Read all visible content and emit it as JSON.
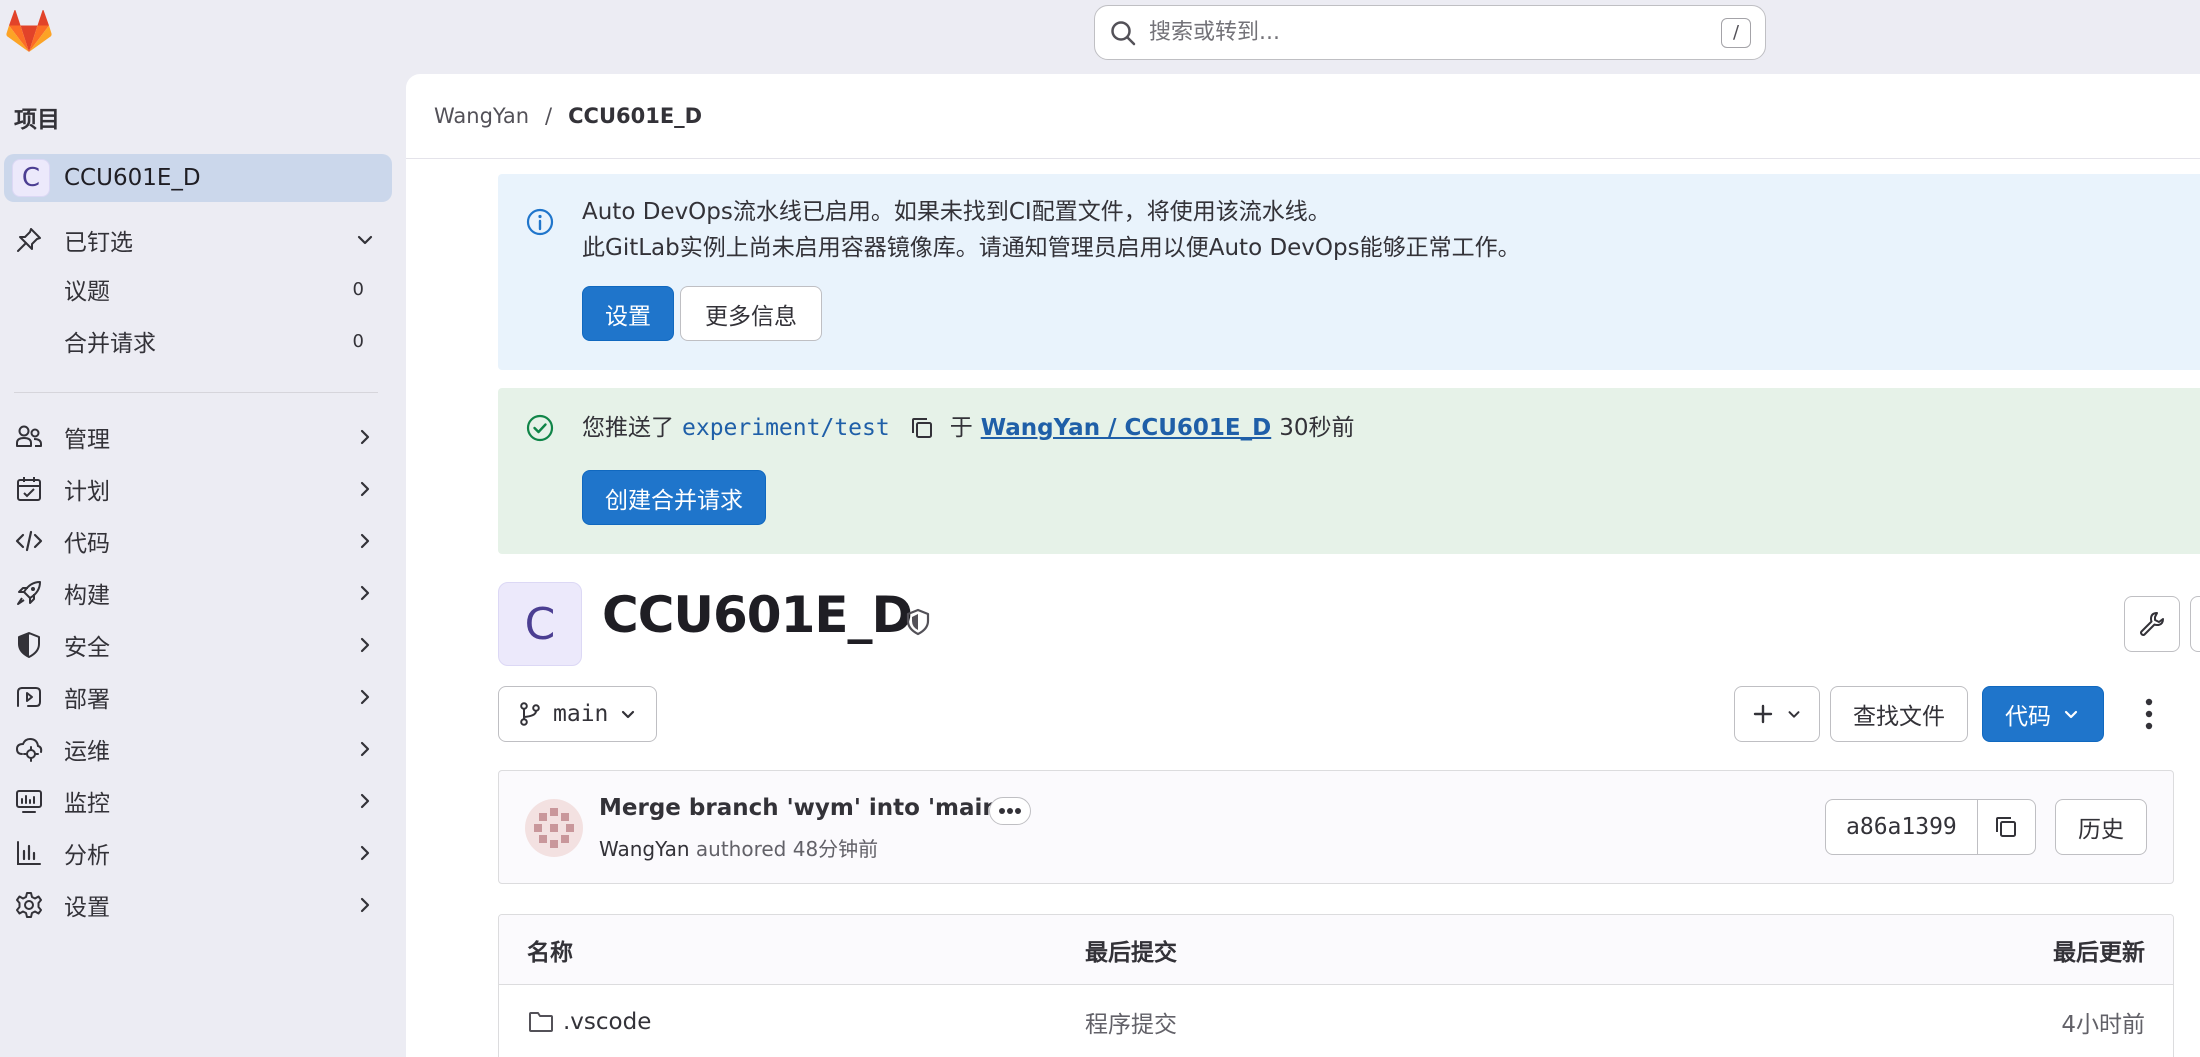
{
  "search": {
    "placeholder": "搜索或转到...",
    "shortcut": "/"
  },
  "sidebar": {
    "heading": "项目",
    "project": {
      "avatar_letter": "C",
      "name": "CCU601E_D"
    },
    "pinned": {
      "label": "已钉选",
      "items": [
        {
          "label": "议题",
          "count": "0"
        },
        {
          "label": "合并请求",
          "count": "0"
        }
      ]
    },
    "items": [
      {
        "label": "管理",
        "icon": "users-icon"
      },
      {
        "label": "计划",
        "icon": "calendar-icon"
      },
      {
        "label": "代码",
        "icon": "code-icon"
      },
      {
        "label": "构建",
        "icon": "rocket-icon"
      },
      {
        "label": "安全",
        "icon": "shield-icon"
      },
      {
        "label": "部署",
        "icon": "deployments-icon"
      },
      {
        "label": "运维",
        "icon": "cloud-gear-icon"
      },
      {
        "label": "监控",
        "icon": "monitor-icon"
      },
      {
        "label": "分析",
        "icon": "chart-icon"
      },
      {
        "label": "设置",
        "icon": "gear-icon"
      }
    ]
  },
  "breadcrumb": {
    "owner": "WangYan",
    "separator": "/",
    "project": "CCU601E_D"
  },
  "alert_info": {
    "line1": "Auto DevOps流水线已启用。如果未找到CI配置文件，将使用该流水线。",
    "line2": "此GitLab实例上尚未启用容器镜像库。请通知管理员启用以便Auto DevOps能够正常工作。",
    "primary_btn": "设置",
    "secondary_btn": "更多信息"
  },
  "alert_success": {
    "prefix": "您推送了",
    "branch": "experiment/test",
    "mid": "于",
    "link": "WangYan / CCU601E_D",
    "time": "30秒前",
    "button": "创建合并请求"
  },
  "project": {
    "avatar_letter": "C",
    "title": "CCU601E_D"
  },
  "toolbar": {
    "branch": "main",
    "find_file": "查找文件",
    "code": "代码"
  },
  "commit": {
    "message": "Merge branch 'wym' into 'main'",
    "author": "WangYan",
    "authored": "authored",
    "time": "48分钟前",
    "sha": "a86a1399",
    "history": "历史"
  },
  "files": {
    "headers": {
      "name": "名称",
      "last_commit": "最后提交",
      "last_update": "最后更新"
    },
    "rows": [
      {
        "name": ".vscode",
        "last_commit": "程序提交",
        "last_update": "4小时前"
      }
    ]
  },
  "colors": {
    "brand": "#fc6d26",
    "primary": "#1f75cb",
    "info_bg": "#e9f3fc",
    "success_bg": "#e6f2e8",
    "success_icon": "#108548"
  }
}
